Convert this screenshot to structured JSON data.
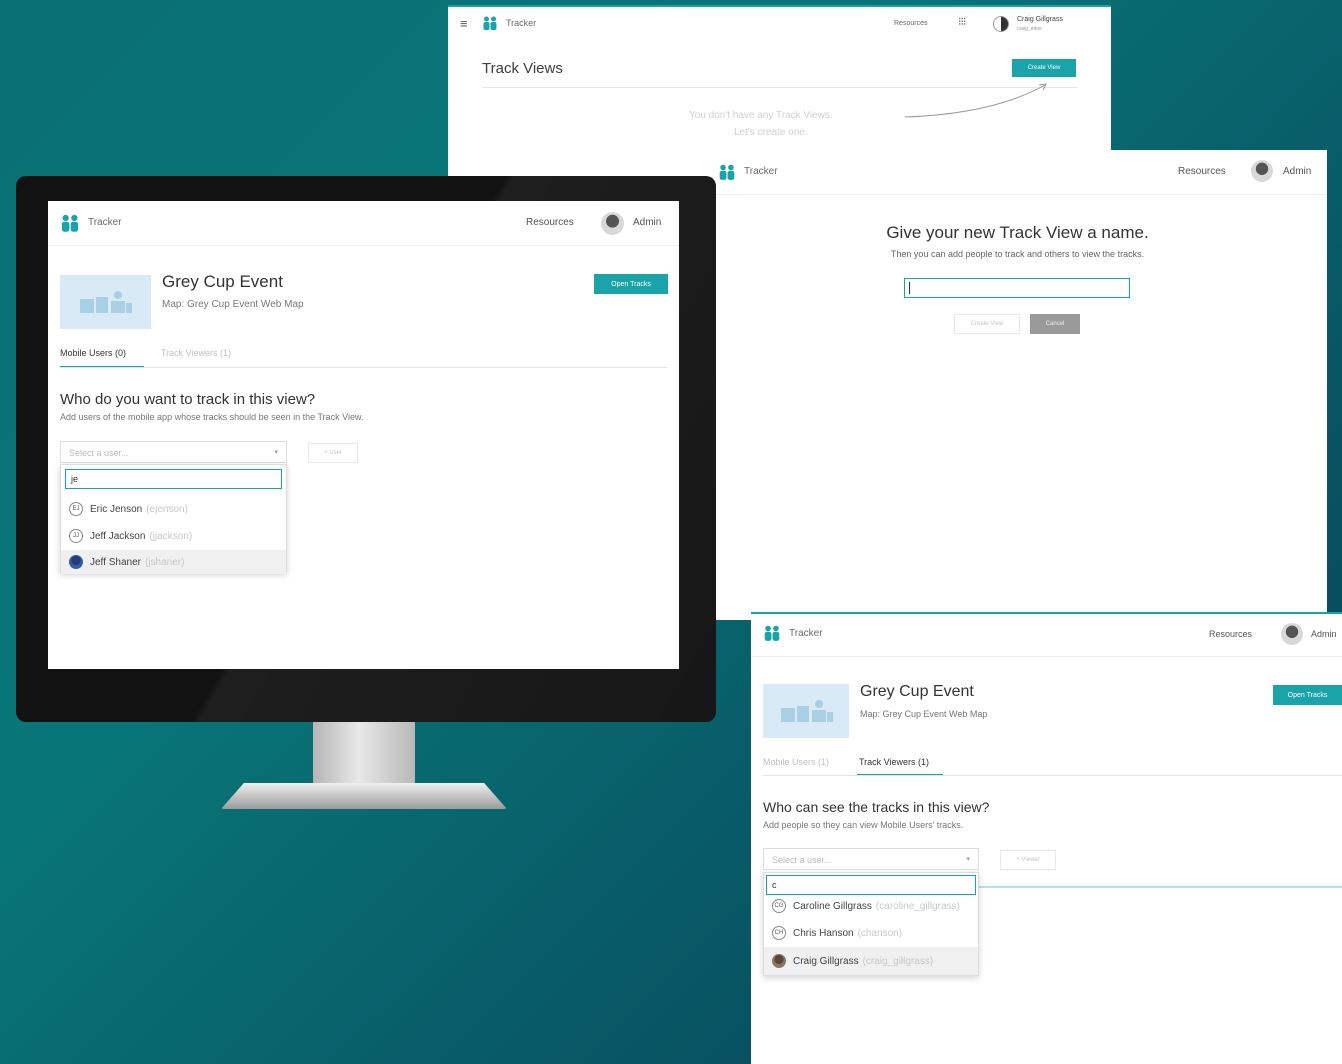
{
  "colors": {
    "accent": "#1aa3a8",
    "bg_dark": "#063f55",
    "bg_teal": "#0a7a78"
  },
  "panel_track_views": {
    "app_name": "Tracker",
    "resources": "Resources",
    "user_name": "Craig Gillgrass",
    "user_handle": "craig_ettoe",
    "title": "Track Views",
    "create_button": "Create View",
    "empty_line1": "You don't have any Track Views.",
    "empty_line2": "Let's create one."
  },
  "panel_new_view": {
    "app_name": "Tracker",
    "resources": "Resources",
    "admin": "Admin",
    "heading": "Give your new Track View a name.",
    "subheading": "Then you can add people to track and others to view the tracks.",
    "name_value": "",
    "create_button": "Create View",
    "cancel_button": "Cancel"
  },
  "monitor_panel": {
    "app_name": "Tracker",
    "resources": "Resources",
    "admin": "Admin",
    "event_title": "Grey Cup Event",
    "map_label": "Map: Grey Cup Event Web Map",
    "open_tracks": "Open Tracks",
    "tabs": [
      {
        "label": "Mobile Users (0)"
      },
      {
        "label": "Track Viewers (1)"
      }
    ],
    "question": "Who do you want to track in this view?",
    "description": "Add users of the mobile app whose tracks should be seen in the Track View.",
    "select_placeholder": "Select a user...",
    "add_button": "+ User",
    "search_value": "je",
    "options": [
      {
        "initials": "EJ",
        "name": "Eric Jenson",
        "handle": "(ejenson)"
      },
      {
        "initials": "JJ",
        "name": "Jeff Jackson",
        "handle": "(jjackson)"
      },
      {
        "initials": "",
        "name": "Jeff Shaner",
        "handle": "(jshaner)"
      }
    ]
  },
  "panel_viewers": {
    "app_name": "Tracker",
    "resources": "Resources",
    "admin": "Admin",
    "event_title": "Grey Cup Event",
    "map_label": "Map: Grey Cup Event Web Map",
    "open_tracks": "Open Tracks",
    "tabs": [
      {
        "label": "Mobile Users (1)"
      },
      {
        "label": "Track Viewers (1)"
      }
    ],
    "question": "Who can see the tracks in this view?",
    "description": "Add people so they can view Mobile Users' tracks.",
    "select_placeholder": "Select a user...",
    "add_button": "+ Viewer",
    "search_value": "c",
    "options": [
      {
        "initials": "CG",
        "name": "Caroline Gillgrass",
        "handle": "(caroline_gillgrass)"
      },
      {
        "initials": "CH",
        "name": "Chris Hanson",
        "handle": "(chanson)"
      },
      {
        "initials": "",
        "name": "Craig Gillgrass",
        "handle": "(craig_gillgrass)"
      }
    ]
  }
}
